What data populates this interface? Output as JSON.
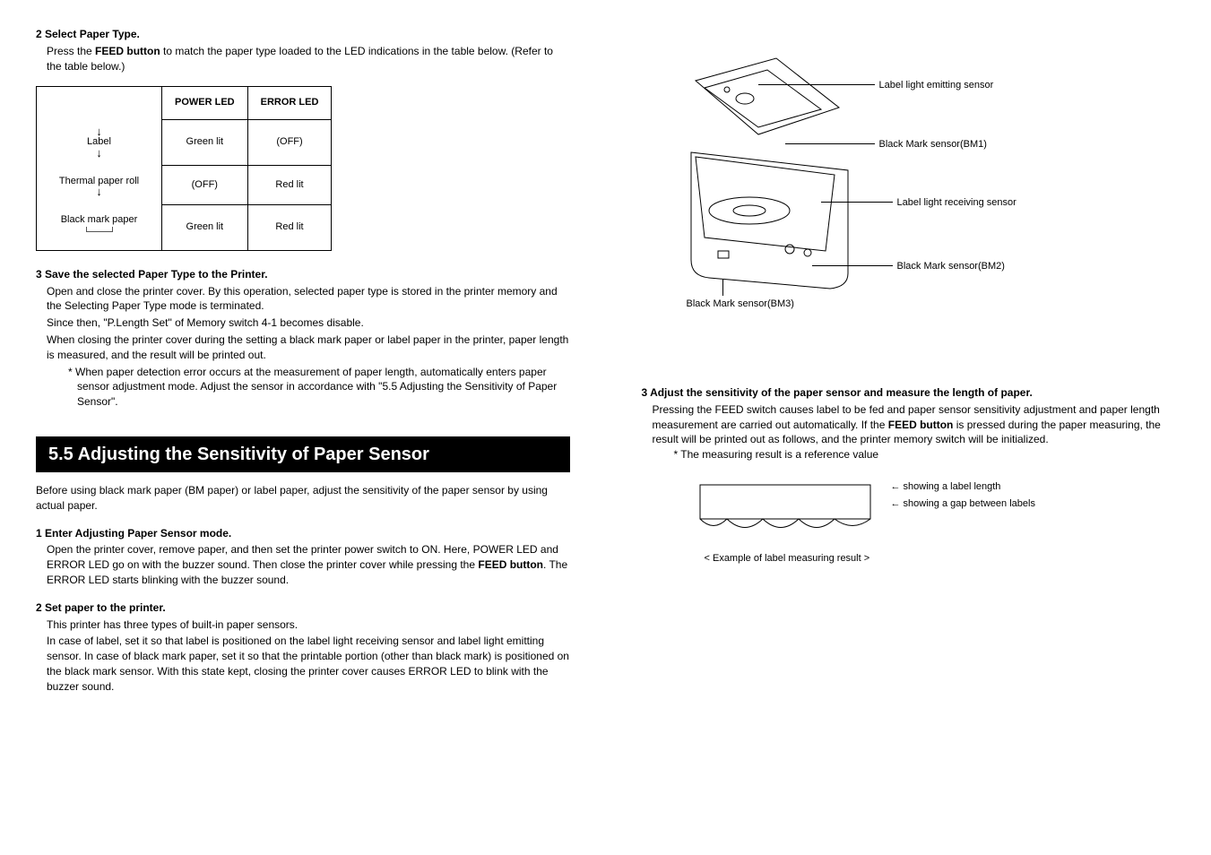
{
  "left": {
    "step2": {
      "heading": "2 Select Paper Type.",
      "body_pre": "Press the ",
      "body_bold": "FEED button",
      "body_post": " to match the paper type loaded to the LED indications in the table below. (Refer to the table below.)"
    },
    "table": {
      "h1": "POWER LED",
      "h2": "ERROR LED",
      "r1": {
        "label": "Label",
        "c1": "Green lit",
        "c2": "(OFF)"
      },
      "r2": {
        "label": "Thermal paper roll",
        "c1": "(OFF)",
        "c2": "Red lit"
      },
      "r3": {
        "label": "Black mark paper",
        "c1": "Green lit",
        "c2": "Red lit"
      }
    },
    "step3": {
      "heading": "3 Save the selected Paper Type to the Printer.",
      "p1": "Open and close the printer cover.  By this operation, selected paper type is stored in the printer memory and the Selecting Paper Type mode is terminated.",
      "p2": "Since then, \"P.Length Set\" of Memory switch 4-1 becomes disable.",
      "p3": "When closing the printer cover during the setting a black mark paper or label paper in the printer, paper length is measured, and the result will be printed out.",
      "note": "* When paper detection error occurs at the measurement of paper length, automatically enters paper sensor adjustment mode. Adjust the sensor in accordance with \"5.5 Adjusting the Sensitivity of Paper Sensor\"."
    },
    "section_title": "5.5  Adjusting the Sensitivity of Paper Sensor",
    "section_intro": "Before using black mark paper (BM paper) or label paper, adjust the sensitivity of the paper sensor by using actual paper.",
    "s1": {
      "heading": "1 Enter Adjusting Paper Sensor mode.",
      "body_pre": "Open the printer cover, remove paper, and then set the printer power switch to ON. Here, POWER LED and ERROR LED go on with the buzzer sound.  Then close the printer cover while pressing the ",
      "body_bold": "FEED button",
      "body_post": ". The ERROR LED starts blinking with the buzzer sound."
    },
    "s2": {
      "heading": "2 Set paper to the printer.",
      "p1": "This printer has three types of built-in paper sensors.",
      "p2": "In case of label, set it so that label is positioned on the label light receiving sensor and label light emitting sensor.  In case of black mark paper, set it so that the printable portion (other than black mark) is positioned on the black mark sensor.  With this state kept, closing the printer cover causes ERROR LED to blink with the buzzer sound."
    }
  },
  "right": {
    "callouts": {
      "emit": "Label light emitting sensor",
      "bm1": "Black Mark sensor(BM1)",
      "recv": "Label light receiving sensor",
      "bm2": "Black Mark sensor(BM2)",
      "bm3": "Black Mark sensor(BM3)"
    },
    "step3": {
      "heading": "3 Adjust the sensitivity of the paper sensor and measure the length of paper.",
      "body_pre": "Pressing the FEED switch causes label to be fed and paper sensor sensitivity adjustment and paper length measurement are carried out automatically. If the ",
      "body_bold": "FEED button",
      "body_post": " is pressed during the paper measuring, the result will be printed out as follows, and the printer memory switch will be initialized.",
      "note": "* The measuring result is a reference value"
    },
    "label_diagram": {
      "line1": "← showing a label length",
      "line2": "← showing a gap between labels",
      "caption": "< Example of label measuring result >"
    }
  }
}
